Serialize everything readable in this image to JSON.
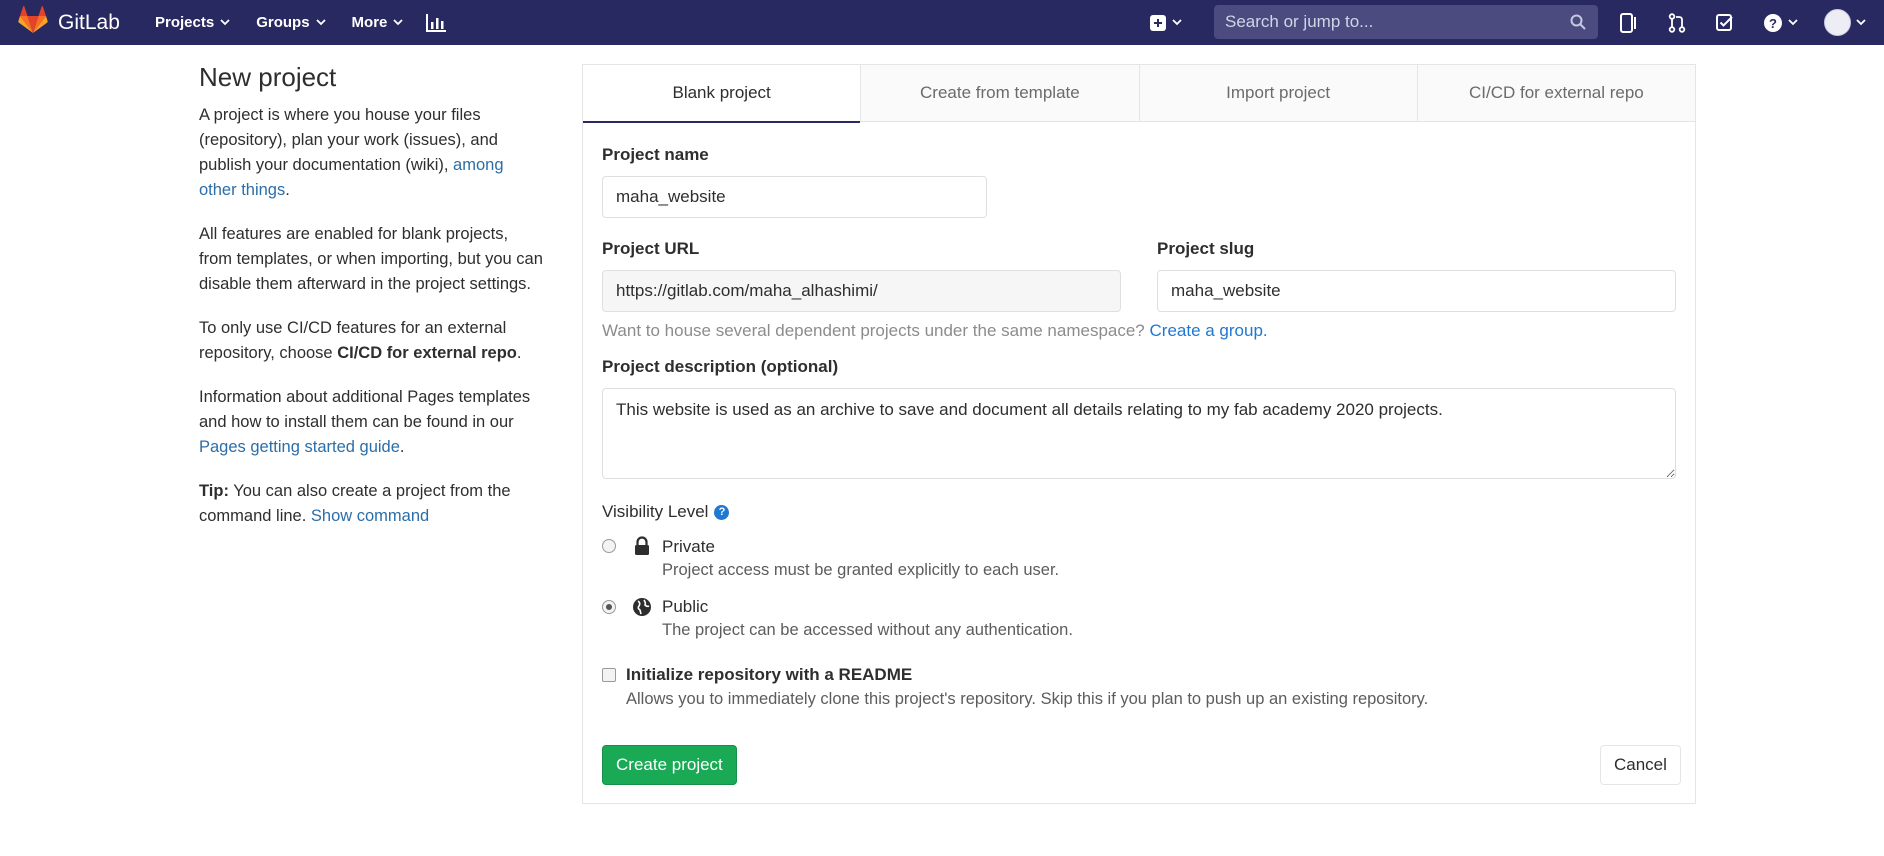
{
  "navbar": {
    "brand": "GitLab",
    "menu": [
      {
        "label": "Projects",
        "icon": "chevron-down-icon"
      },
      {
        "label": "Groups",
        "icon": "chevron-down-icon"
      },
      {
        "label": "More",
        "icon": "chevron-down-icon"
      }
    ],
    "search_placeholder": "Search or jump to...",
    "colors": {
      "bg": "#292961",
      "search_bg": "#4b4b80"
    }
  },
  "intro": {
    "title": "New project",
    "p1_text": "A project is where you house your files (repository), plan your work (issues), and publish your documentation (wiki), ",
    "p1_link": "among other things",
    "p1_end": ".",
    "p2": "All features are enabled for blank projects, from templates, or when importing, but you can disable them afterward in the project settings.",
    "p3_text": "To only use CI/CD features for an external repository, choose ",
    "p3_bold": "CI/CD for external repo",
    "p3_end": ".",
    "p4_text": "Information about additional Pages templates and how to install them can be found in our ",
    "p4_link": "Pages getting started guide",
    "p4_end": ".",
    "tip_label": "Tip:",
    "tip_text": " You can also create a project from the command line. ",
    "tip_link": "Show command"
  },
  "tabs": [
    {
      "label": "Blank project",
      "active": true
    },
    {
      "label": "Create from template",
      "active": false
    },
    {
      "label": "Import project",
      "active": false
    },
    {
      "label": "CI/CD for external repo",
      "active": false
    }
  ],
  "form": {
    "project_name_label": "Project name",
    "project_name_value": "maha_website",
    "project_url_label": "Project URL",
    "project_url_value": "https://gitlab.com/maha_alhashimi/",
    "project_slug_label": "Project slug",
    "project_slug_value": "maha_website",
    "namespace_help": "Want to house several dependent projects under the same namespace? ",
    "namespace_link": "Create a group.",
    "description_label": "Project description (optional)",
    "description_value": "This website is used as an archive to save and document all details relating to my fab academy 2020 projects.",
    "visibility_label": "Visibility Level",
    "visibility_options": [
      {
        "title": "Private",
        "desc": "Project access must be granted explicitly to each user.",
        "icon": "lock-icon",
        "checked": false
      },
      {
        "title": "Public",
        "desc": "The project can be accessed without any authentication.",
        "icon": "globe-icon",
        "checked": true
      }
    ],
    "readme_label": "Initialize repository with a README",
    "readme_desc": "Allows you to immediately clone this project's repository. Skip this if you plan to push up an existing repository.",
    "readme_checked": false,
    "create_button": "Create project",
    "cancel_button": "Cancel",
    "colors": {
      "create_bg": "#1aaa55",
      "link": "#1f78d1"
    }
  }
}
